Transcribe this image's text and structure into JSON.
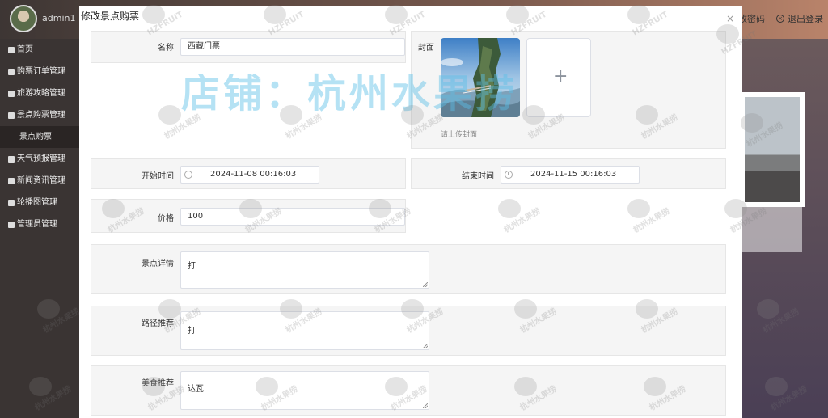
{
  "topbar": {
    "admin_name": "admin1",
    "change_password": "改密码",
    "logout": "退出登录"
  },
  "sidebar": {
    "items": [
      {
        "label": "首页",
        "icon": "home-icon"
      },
      {
        "label": "购票订单管理",
        "icon": "ticket-icon"
      },
      {
        "label": "旅游攻略管理",
        "icon": "guide-icon"
      },
      {
        "label": "景点购票管理",
        "icon": "grid-icon"
      },
      {
        "label": "景点购票",
        "icon": "",
        "sub": true
      },
      {
        "label": "天气预报管理",
        "icon": "weather-icon"
      },
      {
        "label": "新闻资讯管理",
        "icon": "news-icon"
      },
      {
        "label": "轮播图管理",
        "icon": "carousel-icon"
      },
      {
        "label": "管理员管理",
        "icon": "user-icon"
      }
    ]
  },
  "modal": {
    "title": "修改景点购票",
    "close": "×",
    "fields": {
      "name_label": "名称",
      "name_value": "西藏门票",
      "cover_label": "封面",
      "cover_tip": "请上传封面",
      "upload_plus": "+",
      "start_label": "开始时间",
      "start_value": "2024-11-08 00:16:03",
      "end_label": "结束时间",
      "end_value": "2024-11-15 00:16:03",
      "price_label": "价格",
      "price_value": "100",
      "detail_label": "景点详情",
      "detail_value": "打",
      "route_label": "路径推荐",
      "route_value": "打",
      "food_label": "美食推荐",
      "food_value": "达瓦"
    }
  },
  "watermark": {
    "shop": "店铺：杭州水果捞",
    "brand": "杭州水果捞",
    "brand_en": "HZFRUIT"
  },
  "colors": {
    "sidebar_bg": "#3a3433",
    "watermark_blue": "#5abee6",
    "section_bg": "#f5f5f5"
  }
}
